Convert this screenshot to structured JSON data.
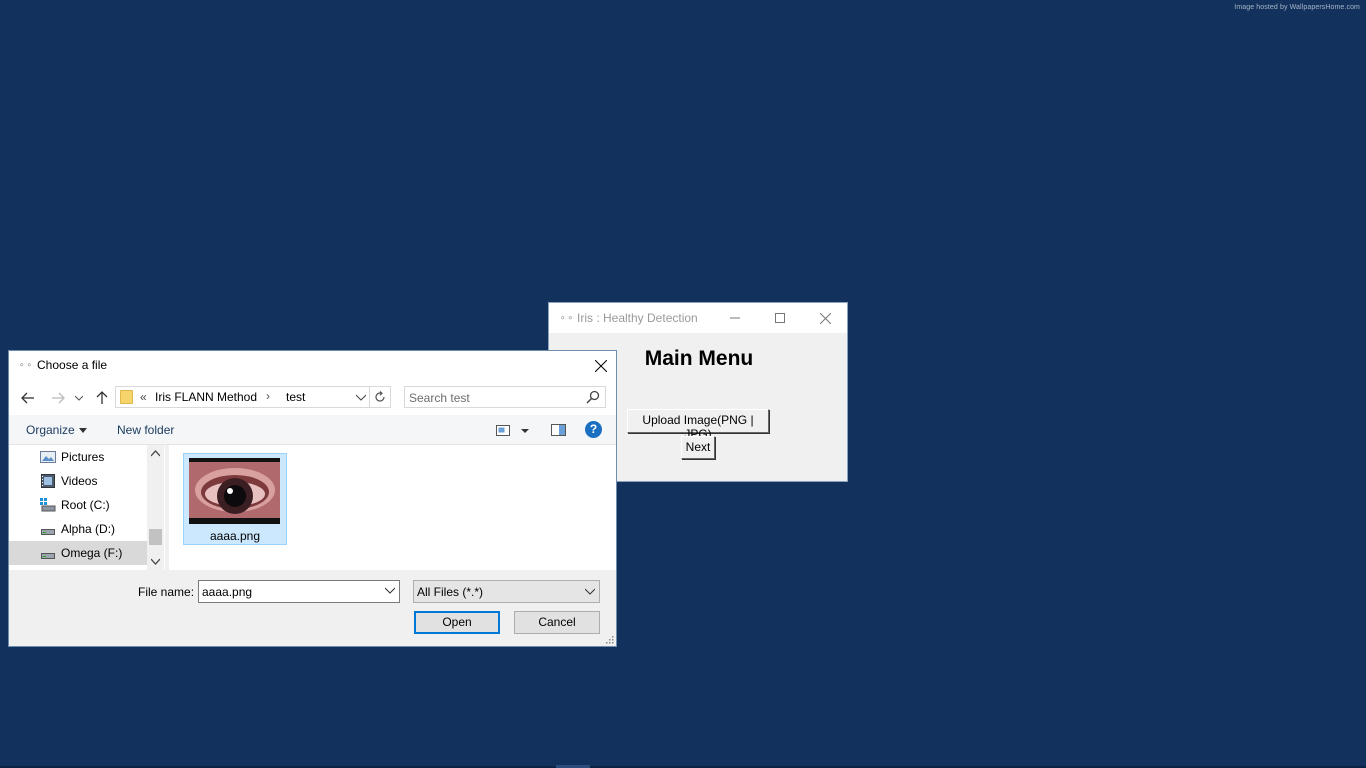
{
  "watermark": "Image hosted by WallpapersHome.com",
  "main_window": {
    "title": "Iris : Healthy Detection",
    "heading": "Main Menu",
    "upload_label": "Upload Image(PNG | JPG)",
    "next_label": "Next"
  },
  "dialog": {
    "title": "Choose a file",
    "breadcrumb": [
      "Iris FLANN Method",
      "test"
    ],
    "breadcrumb_overflow": "«",
    "search_placeholder": "Search test",
    "toolbar": {
      "organize_label": "Organize",
      "new_folder_label": "New folder",
      "help_label": "?"
    },
    "nav_items": [
      {
        "label": "Pictures",
        "icon": "pictures-icon"
      },
      {
        "label": "Videos",
        "icon": "videos-icon"
      },
      {
        "label": "Root (C:)",
        "icon": "drive-icon"
      },
      {
        "label": "Alpha (D:)",
        "icon": "drive-icon"
      },
      {
        "label": "Omega (F:)",
        "icon": "drive-icon",
        "selected": true
      }
    ],
    "files": [
      {
        "name": "aaaa.png",
        "selected": true
      }
    ],
    "file_name_label": "File name:",
    "file_name_value": "aaaa.png",
    "filter_value": "All Files (*.*)",
    "open_label": "Open",
    "cancel_label": "Cancel"
  },
  "colors": {
    "desktop": "#12315c",
    "selection": "#cce8ff",
    "accent": "#0078d7"
  }
}
